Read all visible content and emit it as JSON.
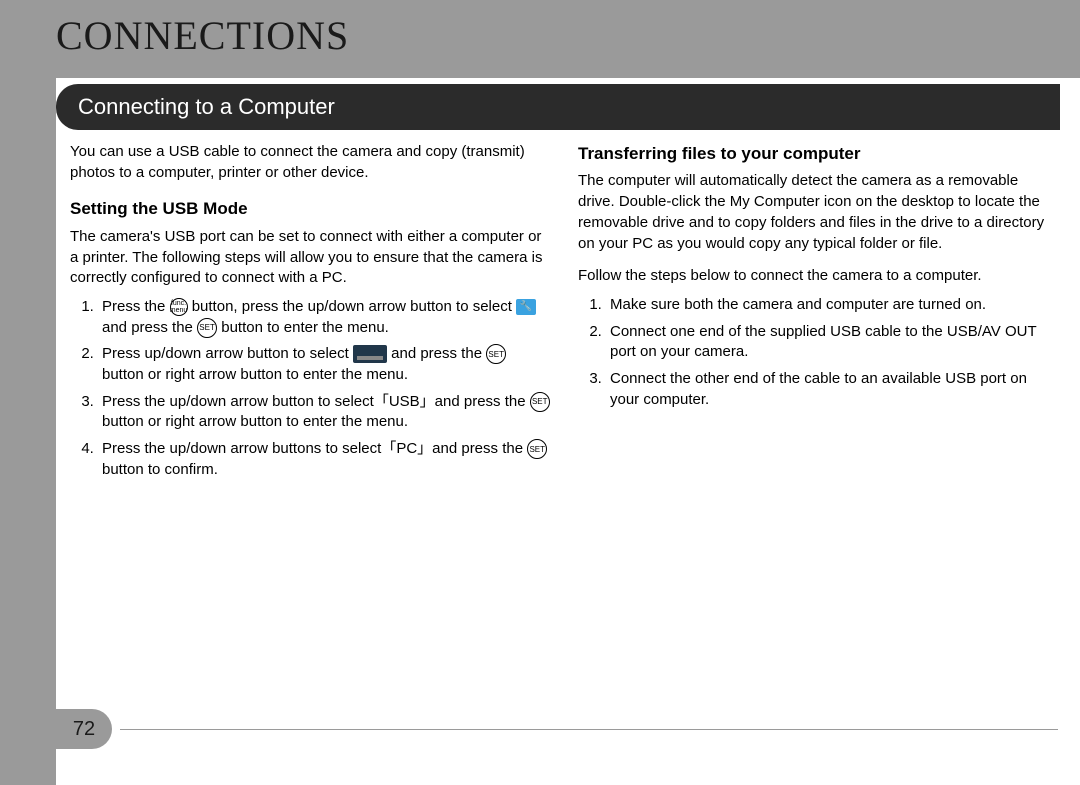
{
  "page_number": "72",
  "chapter_title": "CONNECTIONS",
  "section_title": "Connecting to a Computer",
  "left": {
    "intro": "You can use a USB cable to connect the camera and copy (transmit) photos to a computer, printer or other device.",
    "heading": "Setting the USB Mode",
    "para": "The camera's USB port can be set to connect with either a computer or a printer. The following steps will allow you to ensure that the camera is correctly configured to connect with a PC.",
    "steps": {
      "s1a": "Press the ",
      "s1b": " button, press the up/down arrow button to select ",
      "s1c": " and press the ",
      "s1d": " button to enter the menu.",
      "s2a": "Press up/down arrow button to select ",
      "s2b": " and press the ",
      "s2c": " button or right arrow button to enter the menu.",
      "s3": "Press the up/down arrow button to select「USB」and press the ",
      "s3b": " button or right arrow button to enter the menu.",
      "s4": "Press the up/down arrow buttons to select「PC」and press the ",
      "s4b": " button to confirm."
    }
  },
  "right": {
    "heading": "Transferring files to your computer",
    "para1": "The computer will automatically detect the camera as a removable drive. Double-click the My Computer icon on the desktop to locate the removable drive and to copy folders and files in the drive to a directory on your PC as you would copy any typical folder or file.",
    "para2": "Follow the steps below to connect the camera to a computer.",
    "steps": [
      "Make sure both the camera and computer are turned on.",
      "Connect one end of the supplied USB cable to the USB/AV OUT port on your camera.",
      "Connect the other end of the cable to an available USB port on your computer."
    ]
  },
  "icons": {
    "set_label": "SET",
    "menu_label": "func. menu",
    "wrench": "🔧"
  }
}
